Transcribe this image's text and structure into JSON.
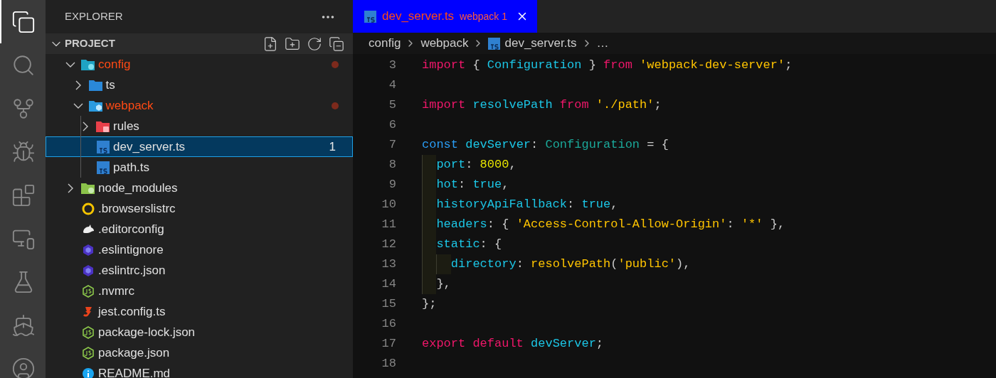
{
  "activity_bar": [
    {
      "kind": "files",
      "selected": true
    },
    {
      "kind": "search",
      "selected": false
    },
    {
      "kind": "source-control",
      "selected": false
    },
    {
      "kind": "run-debug",
      "selected": false
    },
    {
      "kind": "extensions",
      "selected": false
    },
    {
      "kind": "remote",
      "selected": false
    },
    {
      "kind": "testing",
      "selected": false
    },
    {
      "kind": "docker",
      "selected": false
    },
    {
      "kind": "account",
      "selected": false
    }
  ],
  "sidebar": {
    "title": "EXPLORER",
    "section": {
      "title": "PROJECT",
      "expanded": true
    },
    "tree": [
      {
        "label": "config",
        "kind": "folder-config",
        "expanded": true,
        "modified": true,
        "selected": false,
        "children": [
          {
            "label": "ts",
            "kind": "folder-ts",
            "expanded": false,
            "modified": false,
            "selected": false
          },
          {
            "label": "webpack",
            "kind": "folder-webpack",
            "expanded": true,
            "modified": true,
            "selected": false,
            "children": [
              {
                "label": "rules",
                "kind": "folder-rules",
                "expanded": false,
                "modified": false,
                "selected": false
              },
              {
                "label": "dev_server.ts",
                "kind": "ts",
                "modified": false,
                "selected": true,
                "badge": "1"
              },
              {
                "label": "path.ts",
                "kind": "ts",
                "modified": false,
                "selected": false
              }
            ]
          }
        ]
      },
      {
        "label": "node_modules",
        "kind": "folder-node",
        "expanded": false,
        "modified": false,
        "selected": false
      },
      {
        "label": ".browserslistrc",
        "kind": "browserslist",
        "modified": false,
        "selected": false
      },
      {
        "label": ".editorconfig",
        "kind": "editorconfig",
        "modified": false,
        "selected": false
      },
      {
        "label": ".eslintignore",
        "kind": "eslint",
        "modified": false,
        "selected": false
      },
      {
        "label": ".eslintrc.json",
        "kind": "eslint",
        "modified": false,
        "selected": false
      },
      {
        "label": ".nvmrc",
        "kind": "js",
        "modified": false,
        "selected": false
      },
      {
        "label": "jest.config.ts",
        "kind": "jest",
        "modified": false,
        "selected": false
      },
      {
        "label": "package-lock.json",
        "kind": "js",
        "modified": false,
        "selected": false
      },
      {
        "label": "package.json",
        "kind": "js",
        "modified": false,
        "selected": false
      },
      {
        "label": "README.md",
        "kind": "info",
        "modified": false,
        "selected": false
      }
    ]
  },
  "tabs": [
    {
      "title": "dev_server.ts",
      "description": "webpack",
      "badge": "1",
      "selected": true
    }
  ],
  "breadcrumbs": [
    {
      "text": "config",
      "kind": "folder"
    },
    {
      "text": "webpack",
      "kind": "folder"
    },
    {
      "text": "dev_server.ts",
      "kind": "ts"
    },
    {
      "text": "…",
      "kind": "more"
    }
  ],
  "code": [
    {
      "number": "3",
      "tokens": [
        {
          "kind": "keyword",
          "text": "import"
        },
        {
          "kind": "punct",
          "text": " { "
        },
        {
          "kind": "name",
          "text": "Configuration"
        },
        {
          "kind": "punct",
          "text": " } "
        },
        {
          "kind": "keyword",
          "text": "from "
        },
        {
          "kind": "string",
          "text": "'webpack-dev-server'"
        },
        {
          "kind": "punct",
          "text": ";"
        }
      ]
    },
    {
      "number": "4"
    },
    {
      "number": "5",
      "tokens": [
        {
          "kind": "keyword",
          "text": "import "
        },
        {
          "kind": "name",
          "text": "resolvePath "
        },
        {
          "kind": "keyword",
          "text": "from "
        },
        {
          "kind": "string",
          "text": "'./path'"
        },
        {
          "kind": "punct",
          "text": ";"
        }
      ]
    },
    {
      "number": "6"
    },
    {
      "number": "7",
      "tokens": [
        {
          "kind": "storage",
          "text": "const "
        },
        {
          "kind": "name",
          "text": "devServer"
        },
        {
          "kind": "punct",
          "text": ": "
        },
        {
          "kind": "type",
          "text": "Configuration"
        },
        {
          "kind": "punct",
          "text": " = {"
        }
      ]
    },
    {
      "number": "8",
      "tokens": [
        {
          "kind": "name",
          "text": "  port"
        },
        {
          "kind": "punct",
          "text": ": "
        },
        {
          "kind": "number",
          "text": "8000"
        },
        {
          "kind": "punct",
          "text": ","
        }
      ]
    },
    {
      "number": "9",
      "tokens": [
        {
          "kind": "name",
          "text": "  hot"
        },
        {
          "kind": "punct",
          "text": ": "
        },
        {
          "kind": "name",
          "text": "true"
        },
        {
          "kind": "punct",
          "text": ","
        }
      ]
    },
    {
      "number": "10",
      "tokens": [
        {
          "kind": "name",
          "text": "  historyApiFallback"
        },
        {
          "kind": "punct",
          "text": ": "
        },
        {
          "kind": "name",
          "text": "true"
        },
        {
          "kind": "punct",
          "text": ","
        }
      ]
    },
    {
      "number": "11",
      "tokens": [
        {
          "kind": "name",
          "text": "  headers"
        },
        {
          "kind": "punct",
          "text": ": { "
        },
        {
          "kind": "string",
          "text": "'Access-Control-Allow-Origin'"
        },
        {
          "kind": "punct",
          "text": ": "
        },
        {
          "kind": "string",
          "text": "'*'"
        },
        {
          "kind": "punct",
          "text": " },"
        }
      ]
    },
    {
      "number": "12",
      "tokens": [
        {
          "kind": "name",
          "text": "  static"
        },
        {
          "kind": "punct",
          "text": ": {"
        }
      ]
    },
    {
      "number": "13",
      "tokens": [
        {
          "kind": "name",
          "text": "    directory"
        },
        {
          "kind": "punct",
          "text": ": "
        },
        {
          "kind": "function",
          "text": "resolvePath"
        },
        {
          "kind": "punct",
          "text": "("
        },
        {
          "kind": "string",
          "text": "'public'"
        },
        {
          "kind": "punct",
          "text": "),"
        }
      ]
    },
    {
      "number": "14",
      "tokens": [
        {
          "kind": "punct",
          "text": "  },"
        }
      ]
    },
    {
      "number": "15",
      "tokens": [
        {
          "kind": "punct",
          "text": "};"
        }
      ]
    },
    {
      "number": "16"
    },
    {
      "number": "17",
      "tokens": [
        {
          "kind": "keyword",
          "text": "export default "
        },
        {
          "kind": "name",
          "text": "devServer"
        },
        {
          "kind": "punct",
          "text": ";"
        }
      ]
    },
    {
      "number": "18"
    }
  ]
}
